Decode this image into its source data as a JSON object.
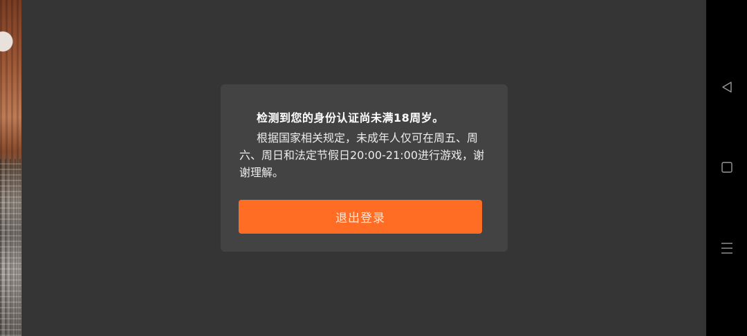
{
  "dialog": {
    "title": "检测到您的身份认证尚未满18周岁。",
    "body": "根据国家相关规定，未成年人仅可在周五、周六、周日和法定节假日20:00-21:00进行游戏，谢谢理解。",
    "exit_button_label": "退出登录"
  },
  "nav_bar": {
    "back_icon": "back-triangle-icon",
    "home_icon": "home-square-icon",
    "menu_icon": "menu-lines-icon"
  },
  "colors": {
    "overlay": "#353535",
    "dialog_bg": "#434343",
    "accent_button": "#ff6d25",
    "nav_bar": "#000000"
  }
}
